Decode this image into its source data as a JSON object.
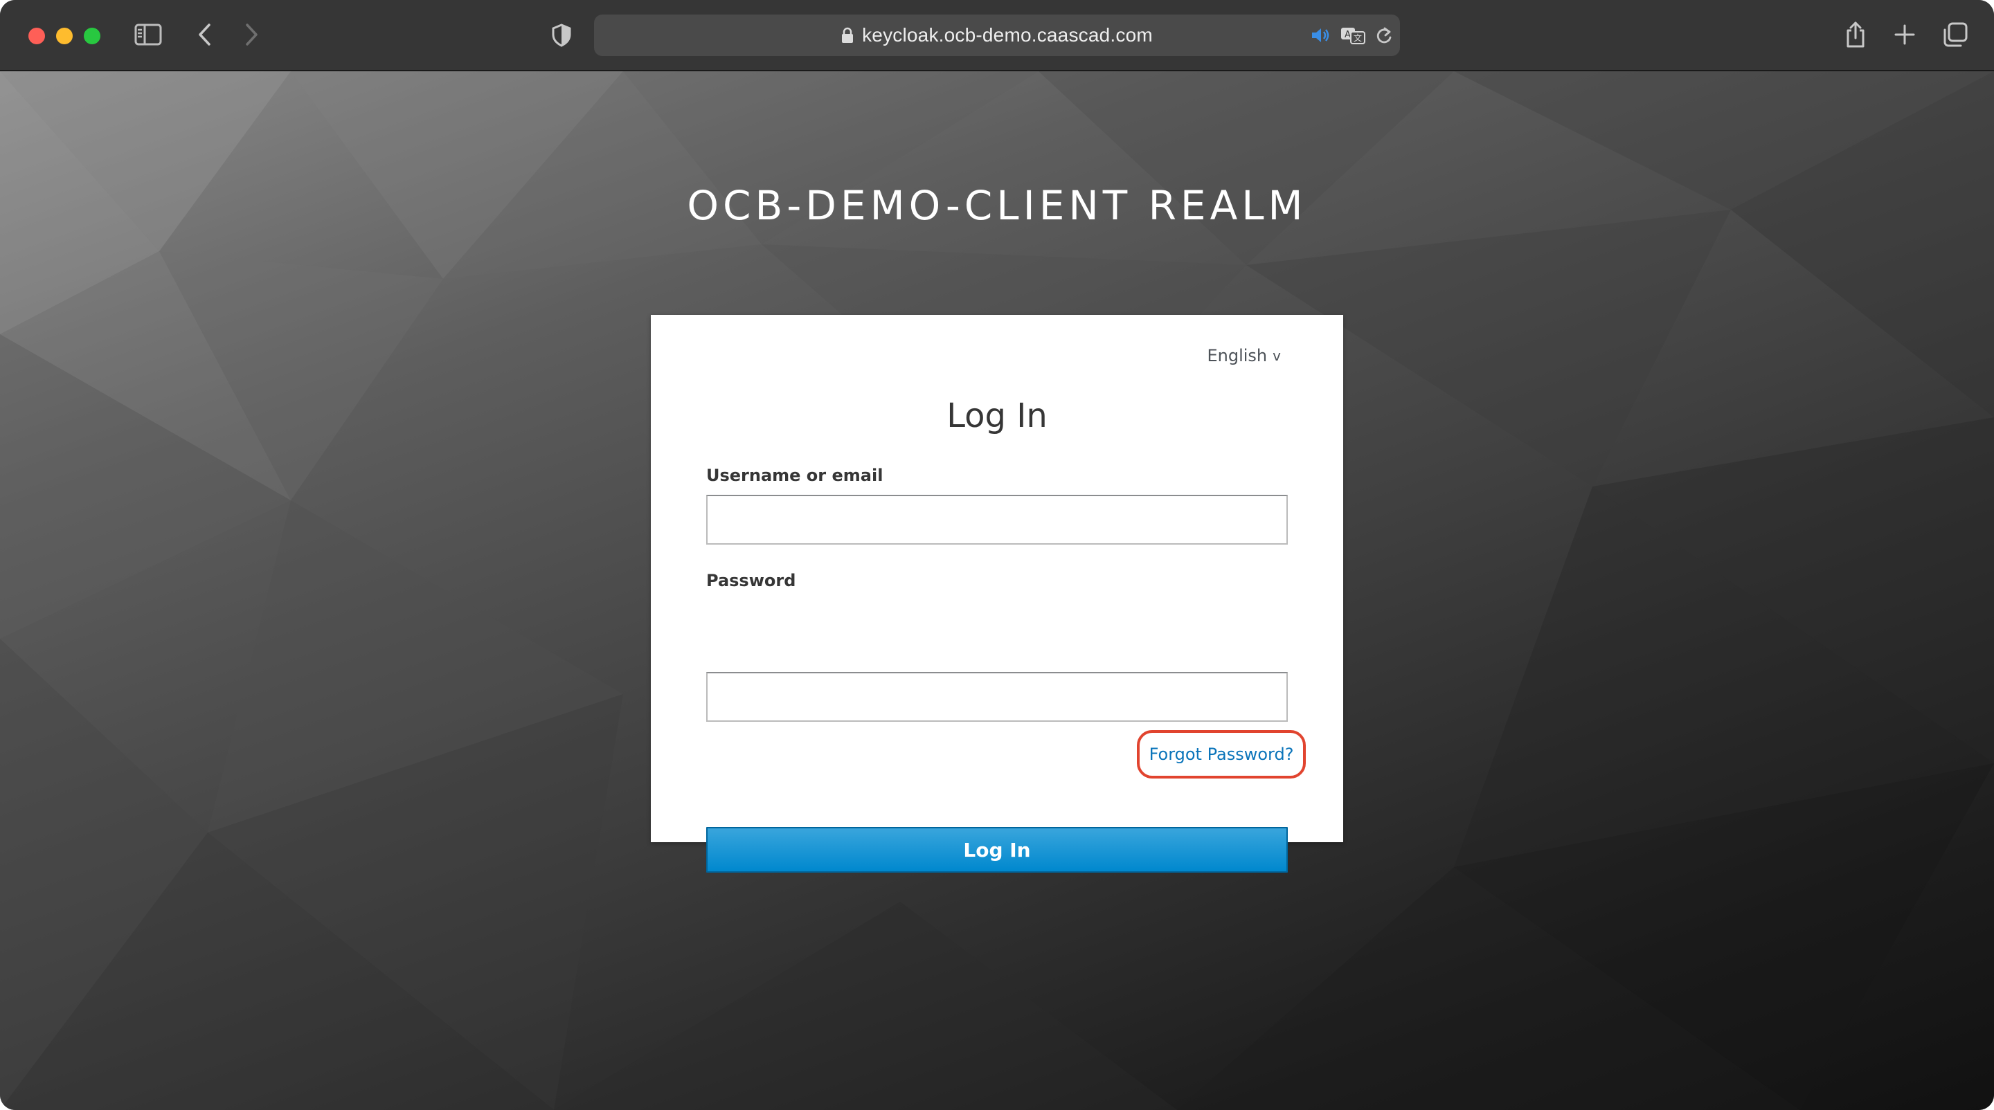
{
  "browser": {
    "url": "keycloak.ocb-demo.caascad.com",
    "icons": {
      "sidebar": "sidebar-icon",
      "back": "chevron-left-icon",
      "forward": "chevron-right-icon",
      "shield": "shield-icon",
      "lock": "lock-icon",
      "speaker": "speaker-icon",
      "translate": "translate-icon",
      "reload": "reload-icon",
      "share": "share-icon",
      "new_tab": "plus-icon",
      "tabs": "tab-overview-icon"
    }
  },
  "page": {
    "realm_title": "OCB-DEMO-CLIENT REALM",
    "language": "English",
    "form_title": "Log In",
    "username_label": "Username or email",
    "username_value": "",
    "password_label": "Password",
    "password_value": "",
    "forgot_password": "Forgot Password?",
    "login_button": "Log In"
  },
  "colors": {
    "accent_button": "#0088ce",
    "link": "#0a74ba",
    "highlight_ring": "#e1442f"
  }
}
